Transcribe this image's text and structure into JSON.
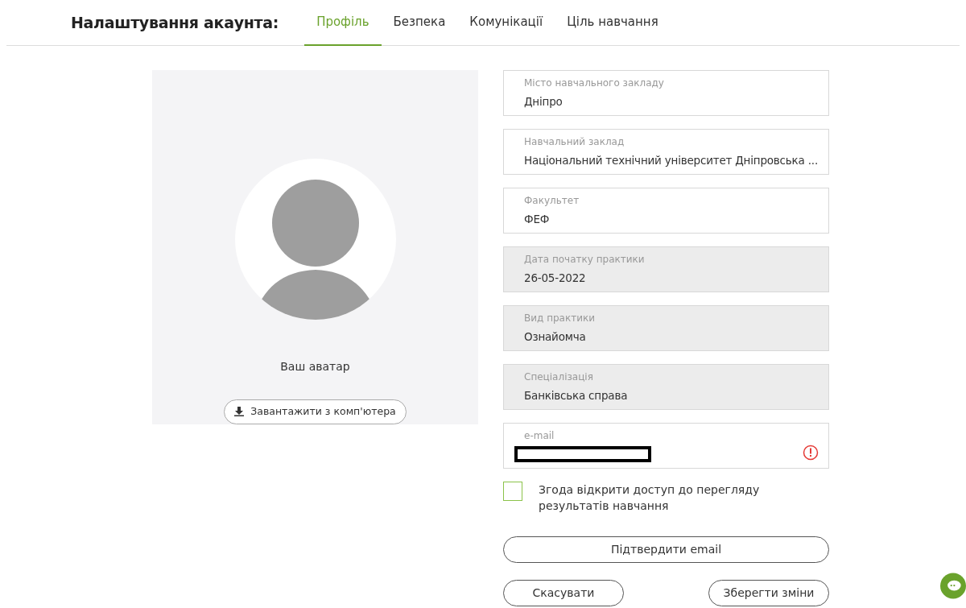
{
  "header": {
    "title": "Налаштування акаунта:"
  },
  "tabs": [
    {
      "label": "Профіль",
      "selected": true
    },
    {
      "label": "Безпека",
      "selected": false
    },
    {
      "label": "Комунікації",
      "selected": false
    },
    {
      "label": "Ціль навчання",
      "selected": false
    }
  ],
  "avatar_panel": {
    "caption": "Ваш аватар",
    "upload_button": "Завантажити з комп'ютера"
  },
  "fields": [
    {
      "label": "Місто навчального закладу",
      "value": "Дніпро",
      "disabled": false,
      "error": false
    },
    {
      "label": "Навчальний заклад",
      "value": "Національний технічний університет Дніпровська ...",
      "disabled": false,
      "error": false
    },
    {
      "label": "Факультет",
      "value": "ФЕФ",
      "disabled": false,
      "error": false
    },
    {
      "label": "Дата початку практики",
      "value": "26-05-2022",
      "disabled": true,
      "error": false
    },
    {
      "label": "Вид практики",
      "value": "Ознайомча",
      "disabled": true,
      "error": false
    },
    {
      "label": "Спеціалізація",
      "value": "Банківська справа",
      "disabled": true,
      "error": false
    },
    {
      "label": "e-mail",
      "redacted": true,
      "disabled": false,
      "error": true
    }
  ],
  "consent": {
    "label": "Згода відкрити доступ до перегляду результатів навчання",
    "checked": false
  },
  "buttons": {
    "confirm": "Підтвердити email",
    "cancel": "Скасувати",
    "save": "Зберегти зміни"
  }
}
